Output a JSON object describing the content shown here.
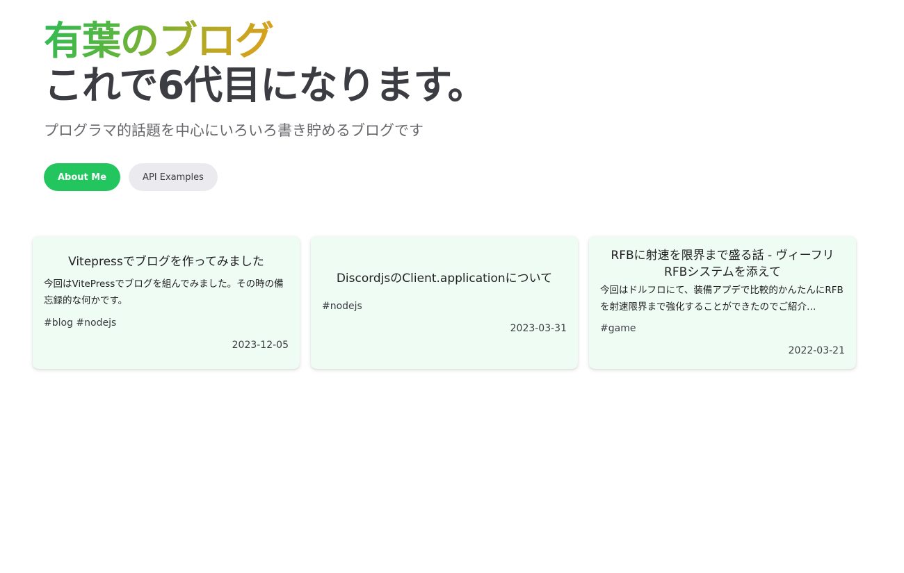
{
  "hero": {
    "name": "有葉のブログ",
    "text": "これで6代目になります。",
    "tagline": "プログラマ的話題を中心にいろいろ書き貯めるブログです"
  },
  "actions": [
    {
      "label": "About Me",
      "theme": "brand"
    },
    {
      "label": "API Examples",
      "theme": "alt"
    }
  ],
  "posts": [
    {
      "title": "Vitepressでブログを作ってみました",
      "description": "今回はVitePressでブログを組んでみました。その時の備忘録的な何かです。",
      "tags": "#blog #nodejs",
      "date": "2023-12-05"
    },
    {
      "title": "DiscordjsのClient.applicationについて",
      "description": "",
      "tags": "#nodejs",
      "date": "2023-03-31"
    },
    {
      "title": "RFBに射速を限界まで盛る話 - ヴィーフリRFBシステムを添えて",
      "description": "今回はドルフロにて、装備アプデで比較的かんたんにRFBを射速限界まで強化することができたのでご紹介…",
      "tags": "#game",
      "date": "2022-03-21"
    }
  ],
  "colors": {
    "brand": "#22c55e",
    "card_bg": "#effcf3",
    "alt_button_bg": "#ebebef"
  }
}
